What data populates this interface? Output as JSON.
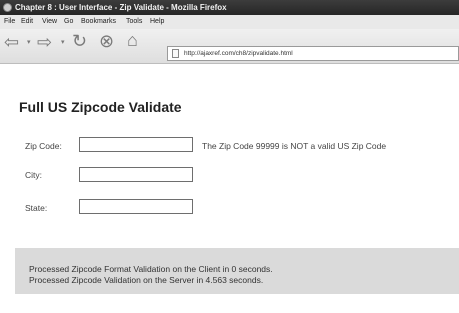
{
  "window": {
    "title": "Chapter 8 : User Interface - Zip Validate - Mozilla Firefox"
  },
  "menu": [
    "File",
    "Edit",
    "View",
    "Go",
    "Bookmarks",
    "Tools",
    "Help"
  ],
  "toolbar": {
    "back_icon": "back-arrow-icon",
    "forward_icon": "forward-arrow-icon",
    "reload_icon": "reload-icon",
    "stop_icon": "stop-icon",
    "home_icon": "home-icon",
    "address_url": "http://ajaxref.com/ch8/zipvalidate.html"
  },
  "page": {
    "heading": "Full US Zipcode Validate",
    "form": {
      "zip_label": "Zip Code:",
      "zip_value": "",
      "zip_message": "The Zip Code 99999 is NOT a valid US Zip Code",
      "city_label": "City:",
      "city_value": "",
      "state_label": "State:",
      "state_value": ""
    },
    "status": {
      "line1": "Processed Zipcode Format Validation on the Client in 0 seconds.",
      "line2": "Processed Zipcode Validation on the Server in 4.563 seconds."
    }
  }
}
